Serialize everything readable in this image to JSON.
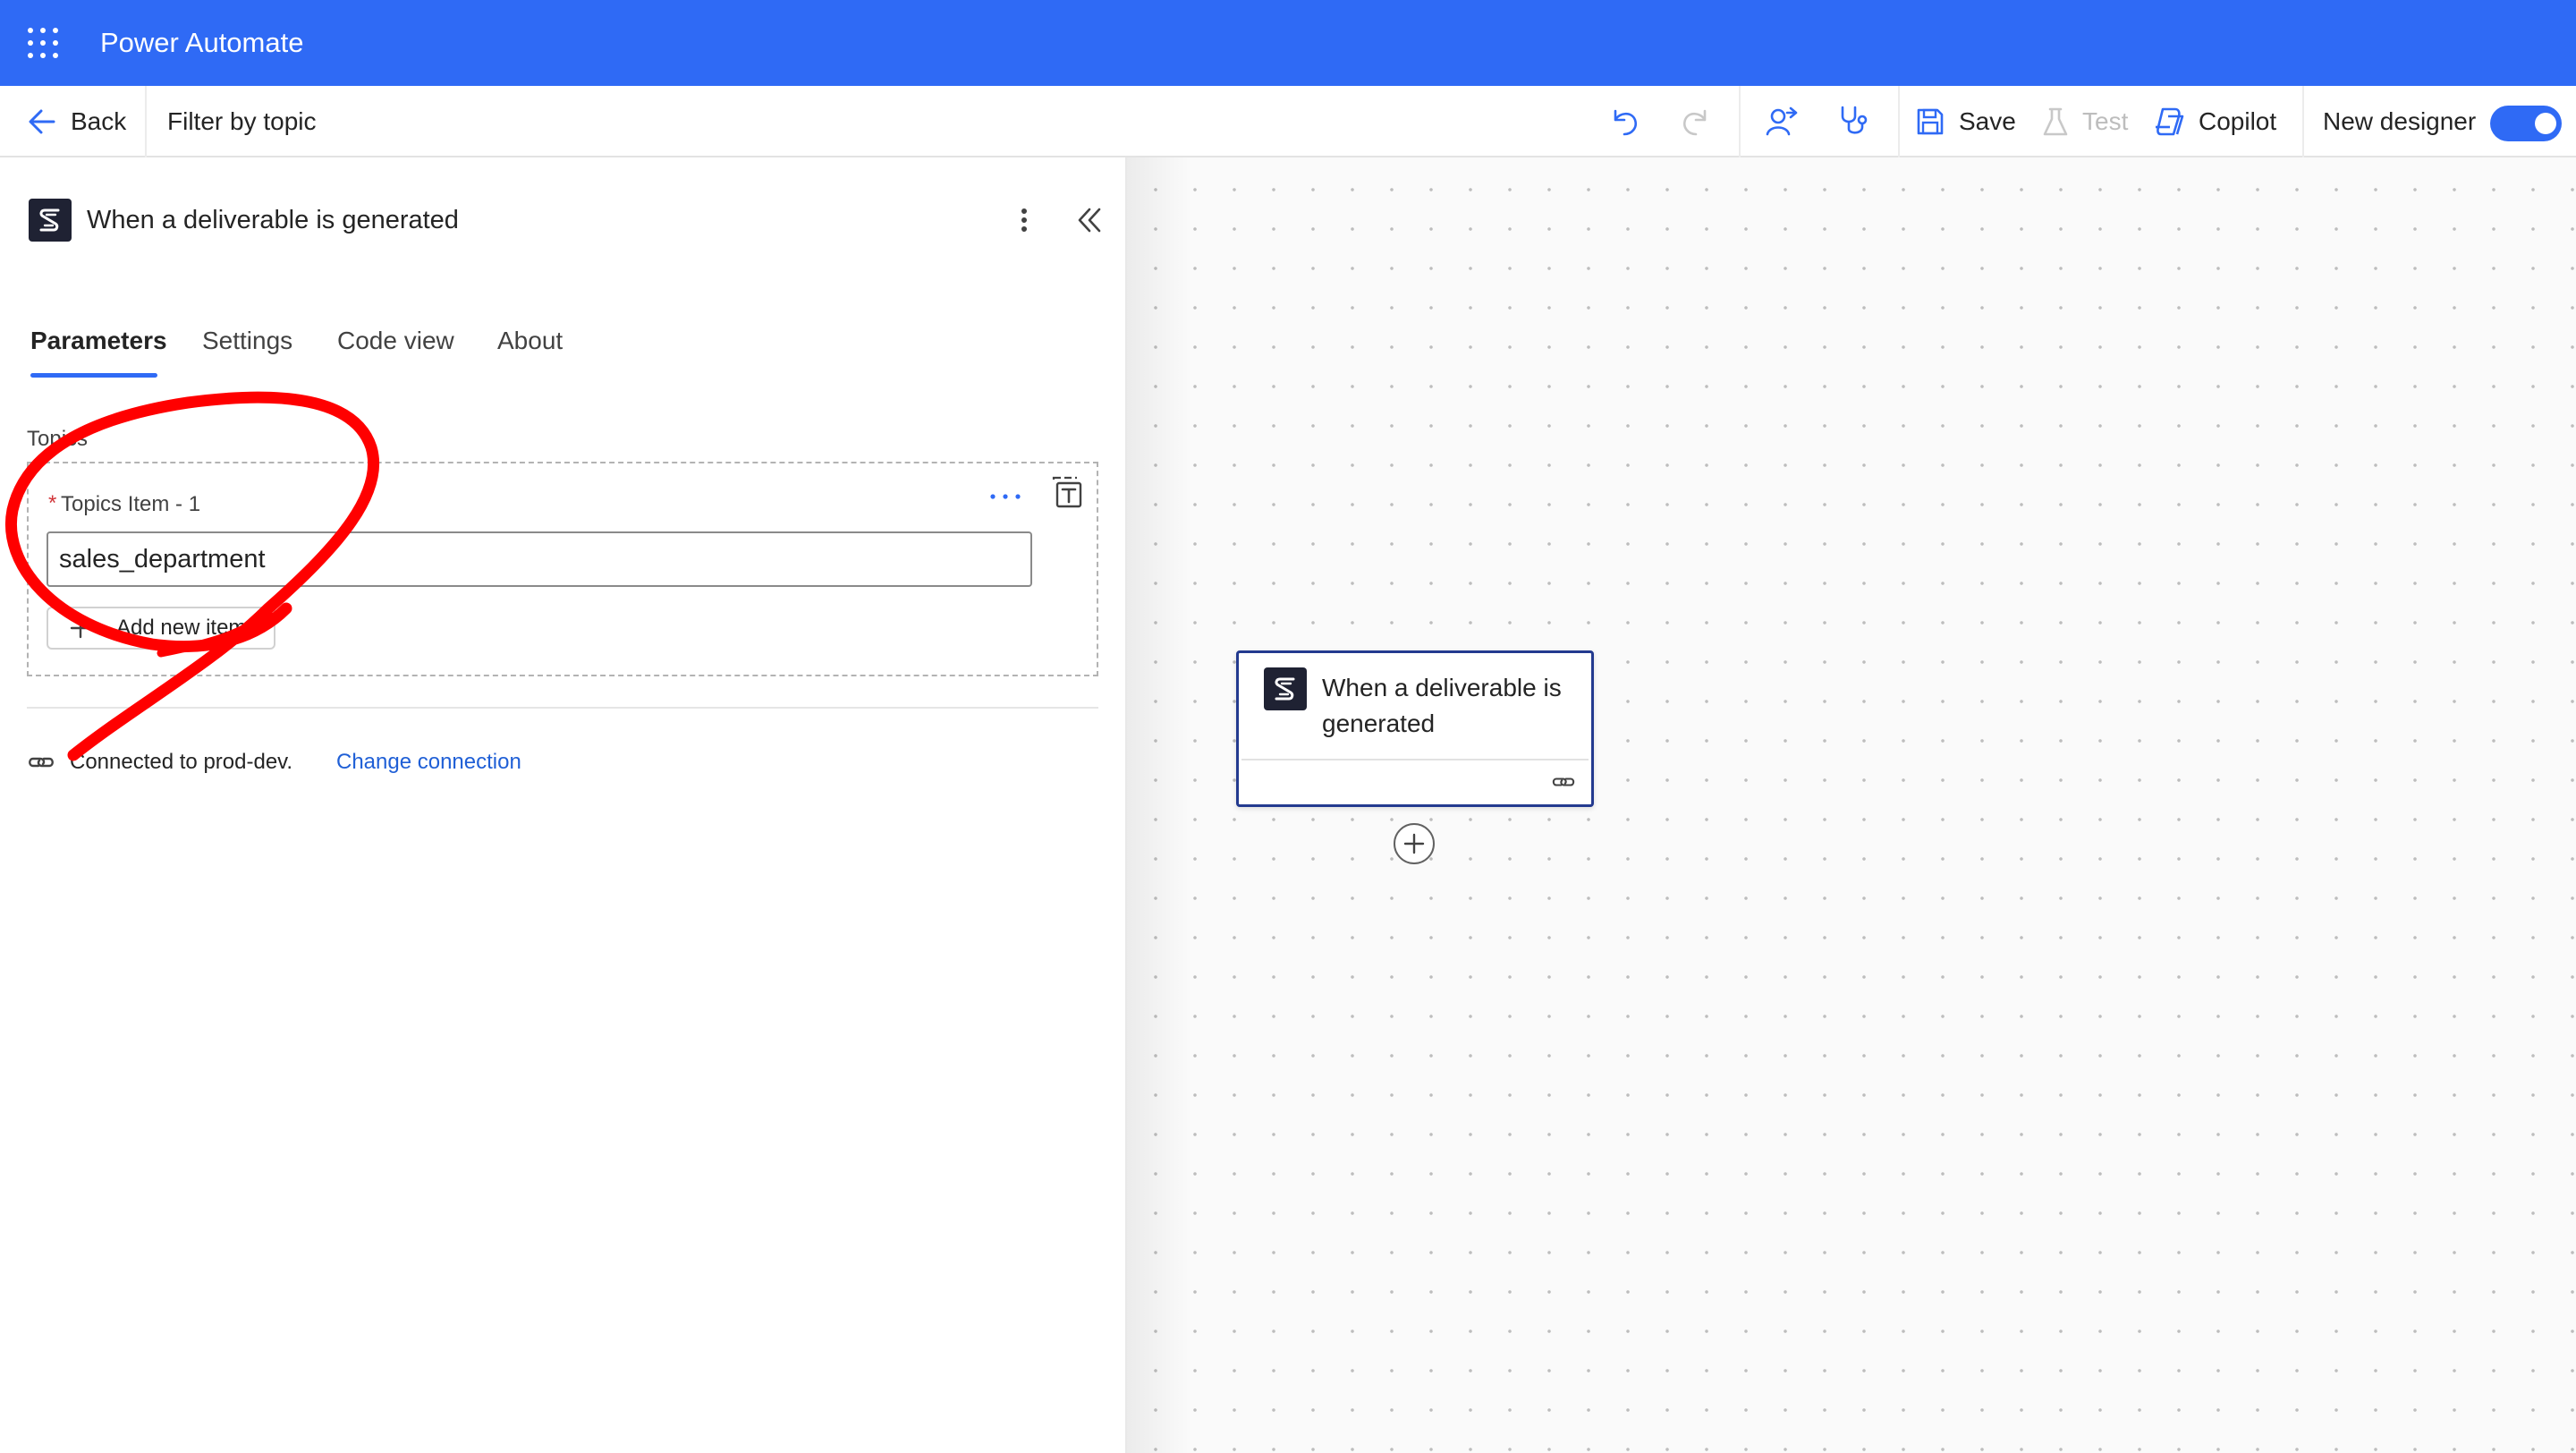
{
  "app": {
    "title": "Power Automate"
  },
  "toolbar": {
    "back_label": "Back",
    "filter_label": "Filter by topic",
    "save_label": "Save",
    "test_label": "Test",
    "copilot_label": "Copilot",
    "new_designer_label": "New designer",
    "new_designer_on": true
  },
  "panel": {
    "trigger_title": "When a deliverable is generated",
    "tabs": [
      {
        "label": "Parameters",
        "active": true
      },
      {
        "label": "Settings",
        "active": false
      },
      {
        "label": "Code view",
        "active": false
      },
      {
        "label": "About",
        "active": false
      }
    ],
    "topics_label": "Topics",
    "item_label": "Topics Item - 1",
    "required_mark": "*",
    "item_value": "sales_department",
    "add_item_label": "Add new item",
    "connection_text": "Connected to prod-dev.",
    "change_connection_label": "Change connection"
  },
  "canvas": {
    "card_title_line1": "When a deliverable is",
    "card_title_line2": "generated"
  },
  "colors": {
    "brand": "#2f6af5",
    "card_border": "#233a8f",
    "link": "#1f5fd6",
    "annotation": "#ff0000"
  }
}
